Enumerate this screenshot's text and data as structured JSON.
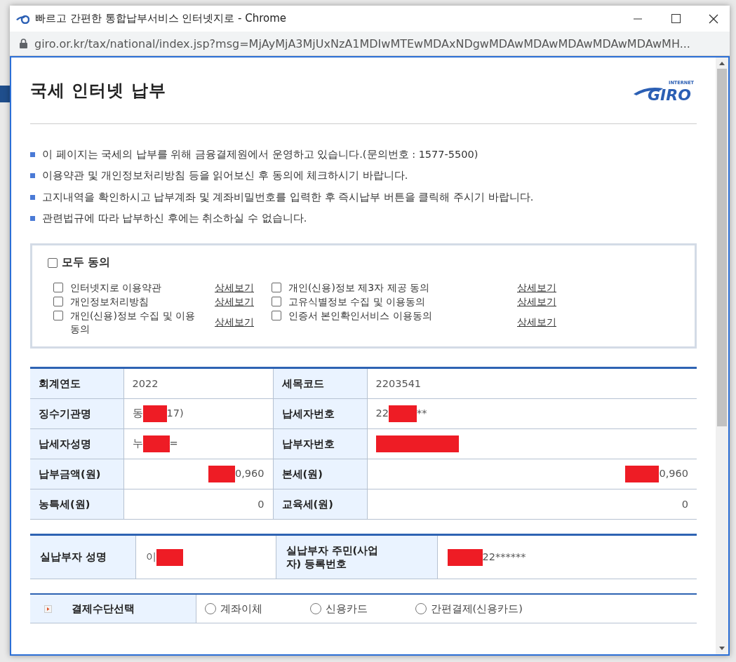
{
  "window": {
    "title": "빠르고 간편한 통합납부서비스 인터넷지로 - Chrome",
    "url": "giro.or.kr/tax/national/index.jsp?msg=MjAyMjA3MjUxNzA1MDIwMTEwMDAxNDgwMDAwMDAwMDAwMDAwMDAwMH..."
  },
  "page": {
    "title": "국세 인터넷 납부",
    "logo_small": "INTERNET",
    "logo": "GIRO"
  },
  "notices": [
    "이 페이지는 국세의 납부를 위해 금융결제원에서 운영하고 있습니다.(문의번호 : 1577-5500)",
    "이용약관 및 개인정보처리방침 등을 읽어보신 후 동의에 체크하시기 바랍니다.",
    "고지내역을 확인하시고 납부계좌 및 계좌비밀번호를 입력한 후 즉시납부 버튼을 클릭해 주시기 바랍니다.",
    "관련법규에 따라 납부하신 후에는 취소하실 수 없습니다."
  ],
  "agree_all": {
    "label": "모두 동의",
    "checked": false
  },
  "agreements": [
    {
      "label": "인터넷지로 이용약관",
      "checked": false,
      "link": "상세보기"
    },
    {
      "label": "개인(신용)정보 제3자 제공 동의",
      "checked": false,
      "link": "상세보기"
    },
    {
      "label": "개인정보처리방침",
      "checked": false,
      "link": "상세보기"
    },
    {
      "label": "고유식별정보 수집 및 이용동의",
      "checked": false,
      "link": "상세보기"
    },
    {
      "label": "개인(신용)정보 수집 및 이용 동의",
      "checked": false,
      "link": "상세보기"
    },
    {
      "label": "인증서 본인확인서비스 이용동의",
      "checked": false,
      "link": "상세보기"
    }
  ],
  "bill": [
    {
      "label": "회계연도",
      "value": {
        "before": "2022"
      },
      "kind": "text"
    },
    {
      "label": "세목코드",
      "value": {
        "before": "2203541"
      },
      "kind": "text"
    },
    {
      "label": "징수기관명",
      "value": {
        "before": "동",
        "redacted": true,
        "after": "17)"
      },
      "kind": "text"
    },
    {
      "label": "납세자번호",
      "value": {
        "before": "22",
        "redacted": true,
        "after": "**"
      },
      "kind": "text"
    },
    {
      "label": "납세자성명",
      "value": {
        "before": "누",
        "redacted": true,
        "after": "="
      },
      "kind": "text"
    },
    {
      "label": "납부자번호",
      "value": {
        "redacted": true
      },
      "kind": "text"
    },
    {
      "label": "납부금액(원)",
      "value": {
        "redacted": true,
        "after": "0,960"
      },
      "kind": "amount"
    },
    {
      "label": "본세(원)",
      "value": {
        "redacted": true,
        "after": "0,960"
      },
      "kind": "amount"
    },
    {
      "label": "농특세(원)",
      "value": {
        "before": "0"
      },
      "kind": "amount"
    },
    {
      "label": "교육세(원)",
      "value": {
        "before": "0"
      },
      "kind": "amount"
    }
  ],
  "payer": [
    {
      "label": "실납부자 성명",
      "value": {
        "before": "이",
        "redacted": true
      }
    },
    {
      "label": "실납부자 주민(사업자) 등록번호",
      "value": {
        "redacted": true,
        "after": "22******"
      }
    }
  ],
  "payment": {
    "label": "결제수단선택",
    "options": [
      {
        "label": "계좌이체",
        "selected": false
      },
      {
        "label": "신용카드",
        "selected": false
      },
      {
        "label": "간편결제(신용카드)",
        "selected": false
      }
    ]
  }
}
